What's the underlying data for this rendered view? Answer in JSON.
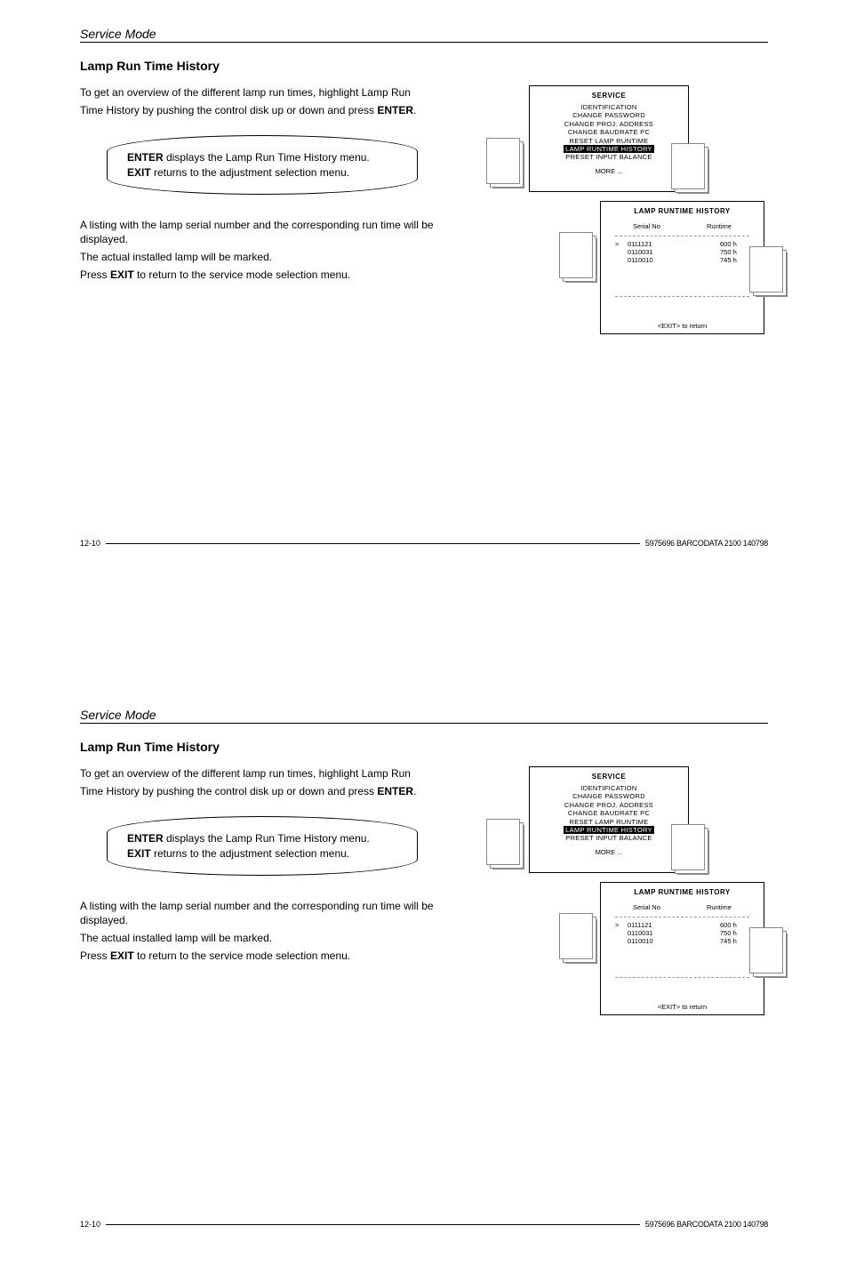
{
  "header": {
    "title": "Service Mode"
  },
  "section": {
    "heading": "Lamp Run Time History"
  },
  "intro": {
    "line1": "To get an overview of the different lamp run times, highlight Lamp Run",
    "line2a": "Time History by pushing the control disk up or down and press ",
    "line2b": "ENTER",
    "line2c": "."
  },
  "callout": {
    "l1a": "ENTER",
    "l1b": " displays the Lamp Run Time History menu.",
    "l2a": "EXIT",
    "l2b": " returns to the adjustment selection menu."
  },
  "body": {
    "p1": "A listing with the lamp serial number and the corresponding run time will be displayed.",
    "p2": "The actual installed lamp will be marked.",
    "p3a": "Press ",
    "p3b": "EXIT",
    "p3c": " to return to the service mode selection menu."
  },
  "osd_service": {
    "title": "SERVICE",
    "items": [
      "IDENTIFICATION",
      "CHANGE PASSWORD",
      "CHANGE PROJ. ADDRESS",
      "CHANGE BAUDRATE PC",
      "RESET LAMP RUNTIME"
    ],
    "highlight": "LAMP RUNTIME HISTORY",
    "after": "PRESET INPUT BALANCE",
    "more": "MORE ..."
  },
  "osd_history": {
    "title": "LAMP RUNTIME HISTORY",
    "col1": "Serial No",
    "col2": "Runtime",
    "rows": [
      {
        "marker": ">",
        "serial": "0111121",
        "runtime": "600 h"
      },
      {
        "marker": "",
        "serial": "0110031",
        "runtime": "750 h"
      },
      {
        "marker": "",
        "serial": "0110010",
        "runtime": "745 h"
      }
    ],
    "exit": "<EXIT> to return"
  },
  "footer": {
    "page": "12-10",
    "docid": "5975696 BARCODATA 2100 140798"
  }
}
